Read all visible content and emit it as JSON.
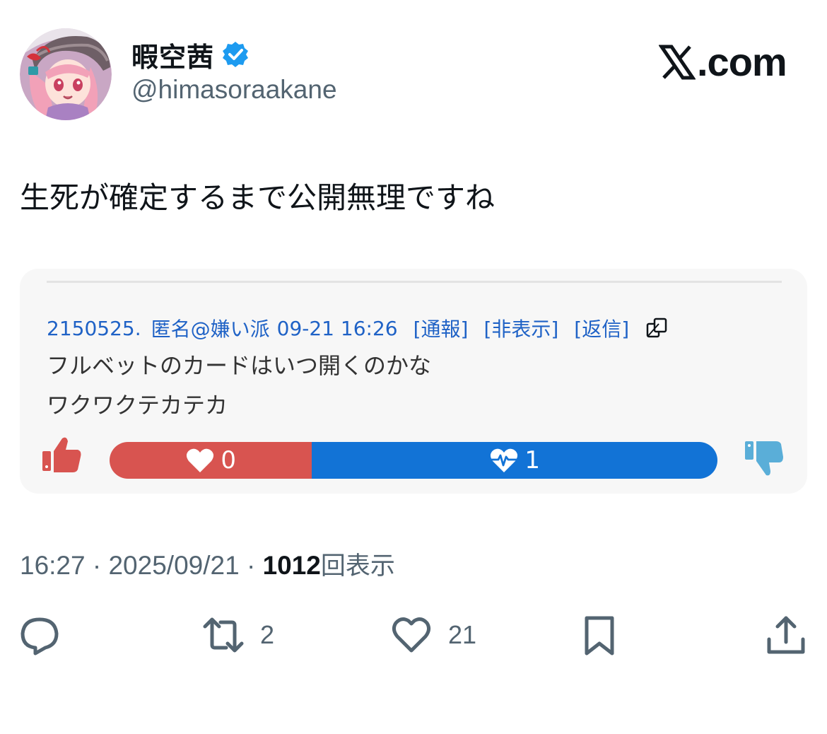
{
  "user": {
    "display_name": "暇空茜",
    "handle": "@himasoraakane",
    "verified": true,
    "verified_color": "#1d9bf0"
  },
  "brand": {
    "logo_text": ".com",
    "logo_icon": "x-logo-icon"
  },
  "tweet": {
    "text": "生死が確定するまで公開無理ですね"
  },
  "quoted_post": {
    "post_number": "2150525.",
    "author": "匿名@嫌い派",
    "datetime": "09-21 16:26",
    "links": [
      "[通報]",
      "[非表示]",
      "[返信]"
    ],
    "lines": [
      "フルベットのカードはいつ開くのかな",
      "ワクワクテカテカ"
    ],
    "votes": {
      "like_count": "0",
      "dislike_count": "1",
      "like_fraction": 0.333,
      "like_color": "#d85450",
      "dislike_color": "#1273d6"
    },
    "link_color": "#1f62c6"
  },
  "meta": {
    "time": "16:27",
    "date": "2025/09/21",
    "separator": "·",
    "views": "1012",
    "views_label": "回表示"
  },
  "actions": {
    "reply_count": "",
    "retweet_count": "2",
    "like_count": "21"
  }
}
